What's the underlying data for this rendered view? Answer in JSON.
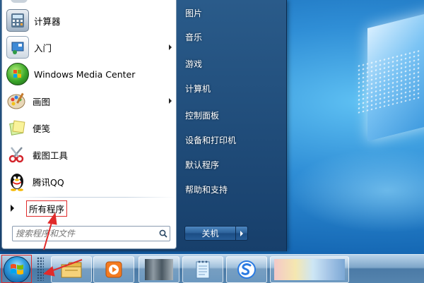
{
  "left_programs": [
    {
      "label": "计算器",
      "icon": "calculator-icon",
      "has_submenu": false
    },
    {
      "label": "入门",
      "icon": "getting-started-icon",
      "has_submenu": true
    },
    {
      "label": "Windows Media Center",
      "icon": "media-center-icon",
      "has_submenu": false
    },
    {
      "label": "画图",
      "icon": "paint-icon",
      "has_submenu": true
    },
    {
      "label": "便笺",
      "icon": "sticky-notes-icon",
      "has_submenu": false
    },
    {
      "label": "截图工具",
      "icon": "snipping-tool-icon",
      "has_submenu": false
    },
    {
      "label": "腾讯QQ",
      "icon": "qq-penguin-icon",
      "has_submenu": false
    }
  ],
  "all_programs": {
    "label": "所有程序"
  },
  "search": {
    "placeholder": "搜索程序和文件"
  },
  "right_items": [
    {
      "label": "图片"
    },
    {
      "label": "音乐"
    },
    {
      "label": "游戏"
    },
    {
      "label": "计算机"
    },
    {
      "label": "控制面板"
    },
    {
      "label": "设备和打印机"
    },
    {
      "label": "默认程序"
    },
    {
      "label": "帮助和支持"
    }
  ],
  "shutdown": {
    "label": "关机"
  },
  "taskbar": {
    "items": [
      "windows-explorer-icon",
      "media-player-icon",
      "blurred-app-icon",
      "notepad-icon",
      "sogou-icon",
      "blurred-app-icon"
    ]
  },
  "colors": {
    "annotation_red": "#e02b2b"
  }
}
